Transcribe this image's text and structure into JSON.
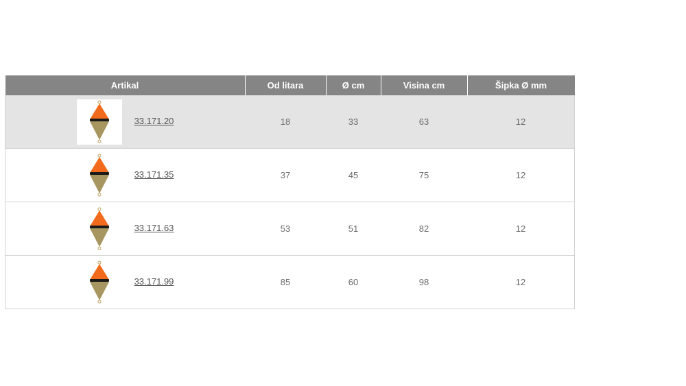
{
  "table": {
    "headers": [
      "Artikal",
      "Od litara",
      "Ø cm",
      "Visina cm",
      "Šipka Ø mm"
    ],
    "rows": [
      {
        "code": "33.171.20",
        "od_litara": "18",
        "diameter": "33",
        "visina": "63",
        "sipka": "12",
        "image_icon": "buoy-icon"
      },
      {
        "code": "33.171.35",
        "od_litara": "37",
        "diameter": "45",
        "visina": "75",
        "sipka": "12",
        "image_icon": "buoy-icon"
      },
      {
        "code": "33.171.63",
        "od_litara": "53",
        "diameter": "51",
        "visina": "82",
        "sipka": "12",
        "image_icon": "buoy-icon"
      },
      {
        "code": "33.171.99",
        "od_litara": "85",
        "diameter": "60",
        "visina": "98",
        "sipka": "12",
        "image_icon": "buoy-icon"
      }
    ]
  },
  "colors": {
    "header_bg": "#858585",
    "highlight_row_bg": "#e4e4e4",
    "buoy_top": "#f26a1b",
    "buoy_bottom": "#a89660",
    "buoy_band": "#1a1a1a"
  }
}
